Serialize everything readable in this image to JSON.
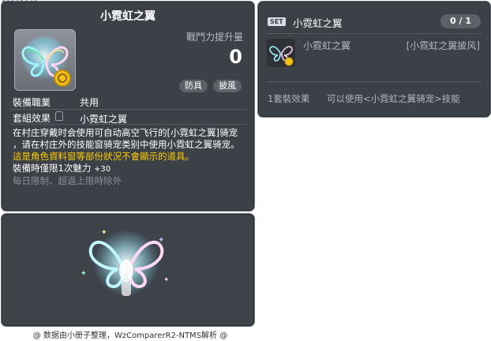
{
  "item_id": "01102948",
  "tooltip": {
    "title": "小霓虹之翼",
    "stat_label": "戰鬥力提升量",
    "stat_value": "0",
    "tags": [
      "防具",
      "披風"
    ],
    "job_label": "裝備職業",
    "job_value": "共用",
    "set_label": "套組效果",
    "set_value": "小霓虹之翼",
    "description": [
      "在村庄穿戴时会使用可自动高空飞行的[小霓虹之翼]骑宠",
      "，请在村庄外的技能窗骑宠类别中使用小霓虹之翼骑宠。"
    ],
    "warning": "這是角色資料窗等部份狀況不會顯示的道具。",
    "equip_limit": "裝備時僅限1次魅力",
    "equip_limit_value": "+30",
    "daily_limit": "每日限制、超過上限時除外"
  },
  "set_panel": {
    "badge": "SET",
    "title": "小霓虹之翼",
    "count": "0 / 1",
    "item_name": "小霓虹之翼",
    "item_right": "[小霓虹之翼披风]",
    "effect_label": "1套裝效果",
    "effect_value": "可以使用<小霓虹之翼骑宠>技能"
  },
  "footer": "@ 数据由小册子整理，WzComparerR2-NTMS解析 @",
  "colors": {
    "panel_bg": "#3c4047",
    "warning": "#ffcc00",
    "muted": "#8d9097"
  }
}
